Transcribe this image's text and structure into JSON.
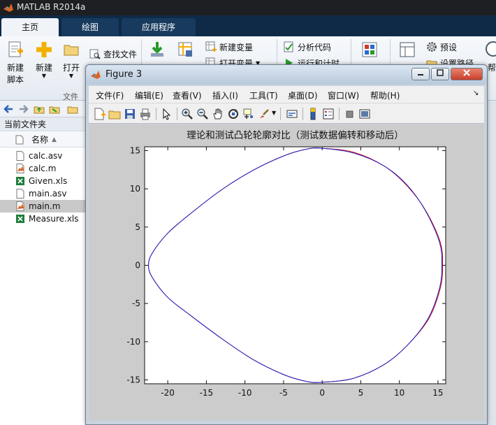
{
  "app": {
    "title": "MATLAB R2014a"
  },
  "tabs": [
    {
      "label": "主页",
      "active": true
    },
    {
      "label": "绘图",
      "active": false
    },
    {
      "label": "应用程序",
      "active": false
    }
  ],
  "ribbon": {
    "new_script": [
      "新建",
      "脚本"
    ],
    "new": "新建",
    "open": "打开",
    "find_files": "查找文件",
    "new_variable": "新建变量",
    "open_variable": "打开变量",
    "analyze_code": "分析代码",
    "run_and_time": "运行和计时",
    "preferences": "预设",
    "set_path": "设置路径",
    "help": "帮",
    "group_file": "文件"
  },
  "file_browser": {
    "header": "当前文件夹",
    "column_name": "名称",
    "files": [
      {
        "name": "calc.asv",
        "selected": false
      },
      {
        "name": "calc.m",
        "selected": false
      },
      {
        "name": "Given.xls",
        "selected": false
      },
      {
        "name": "main.asv",
        "selected": false
      },
      {
        "name": "main.m",
        "selected": true
      },
      {
        "name": "Measure.xls",
        "selected": false
      }
    ]
  },
  "figure": {
    "title": "Figure 3",
    "menu": [
      "文件(F)",
      "编辑(E)",
      "查看(V)",
      "插入(I)",
      "工具(T)",
      "桌面(D)",
      "窗口(W)",
      "帮助(H)"
    ]
  },
  "chart_data": {
    "type": "line",
    "title": "理论和测试凸轮轮廓对比（测试数据偏转和移动后）",
    "xlabel": "",
    "ylabel": "",
    "xlim": [
      -23,
      16
    ],
    "ylim": [
      -15.5,
      15.5
    ],
    "xticks": [
      -20,
      -15,
      -10,
      -5,
      0,
      5,
      10,
      15
    ],
    "yticks": [
      -15,
      -10,
      -5,
      0,
      5,
      10,
      15
    ],
    "grid": false,
    "series": [
      {
        "color": "#cc0000",
        "x": [
          0,
          4,
          8,
          11,
          13.5,
          15.3,
          15.6,
          15.3,
          13.8,
          11,
          8,
          4,
          0,
          -2,
          -5,
          -9,
          -13,
          -17,
          -20,
          -22,
          -22.5,
          -22,
          -20,
          -17,
          -13,
          -9,
          -5,
          -2,
          0
        ],
        "y": [
          15.3,
          14.8,
          13,
          10.4,
          7,
          3,
          0,
          -3,
          -7,
          -10.5,
          -13,
          -14.8,
          -15.3,
          -15.2,
          -14.3,
          -12.3,
          -9.6,
          -6.6,
          -4.2,
          -1.6,
          0,
          1.6,
          4.2,
          6.8,
          9.9,
          12.4,
          14.3,
          15.2,
          15.3
        ]
      },
      {
        "color": "#2222cc",
        "x": [
          0,
          4,
          8,
          11,
          13.4,
          15.2,
          15.5,
          15.2,
          13.7,
          11,
          8,
          4,
          0,
          -2,
          -5,
          -9,
          -13,
          -17,
          -20,
          -22,
          -22.5,
          -22,
          -20,
          -17,
          -13,
          -9,
          -5,
          -2,
          0
        ],
        "y": [
          15.3,
          14.7,
          13,
          10.5,
          7.1,
          3,
          0,
          -3,
          -7,
          -10.5,
          -13,
          -14.8,
          -15.3,
          -15.2,
          -14.3,
          -12.3,
          -9.6,
          -6.6,
          -4.2,
          -1.6,
          0,
          1.6,
          4.2,
          6.8,
          9.9,
          12.4,
          14.3,
          15.2,
          15.3
        ]
      }
    ]
  }
}
